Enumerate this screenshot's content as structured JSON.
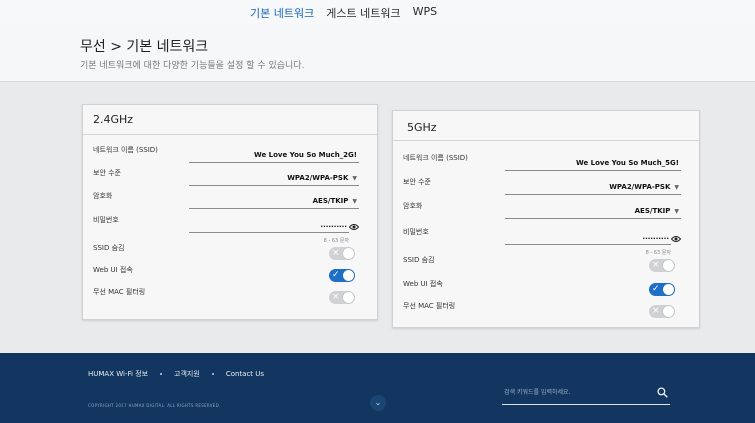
{
  "nav": {
    "tabs": [
      {
        "label": "기본 네트워크",
        "active": true
      },
      {
        "label": "게스트 네트워크",
        "active": false
      },
      {
        "label": "WPS",
        "active": false
      }
    ]
  },
  "header": {
    "title": "무선 > 기본 네트워크",
    "subtitle": "기본 네트워크에 대한 다양한 기능들을 설정 할 수 있습니다."
  },
  "panels": {
    "band24": {
      "title": "2.4GHz",
      "ssid_label": "네트워크 이름 (SSID)",
      "ssid_value": "We Love You So Much_2G!",
      "security_label": "보안 수준",
      "security_value": "WPA2/WPA-PSK",
      "encryption_label": "암호화",
      "encryption_value": "AES/TKIP",
      "password_label": "비밀번호",
      "password_value": "..........",
      "password_hint": "8 - 63 문자",
      "ssid_hide_label": "SSID 숨김",
      "ssid_hide_on": false,
      "webui_label": "Web UI 접속",
      "webui_on": true,
      "mac_label": "무선 MAC 필터링",
      "mac_on": false
    },
    "band5": {
      "title": "5GHz",
      "ssid_label": "네트워크 이름 (SSID)",
      "ssid_value": "We Love You So Much_5G!",
      "security_label": "보안 수준",
      "security_value": "WPA2/WPA-PSK",
      "encryption_label": "암호화",
      "encryption_value": "AES/TKIP",
      "password_label": "비밀번호",
      "password_value": "..........",
      "password_hint": "8 - 63 문자",
      "ssid_hide_label": "SSID 숨김",
      "ssid_hide_on": false,
      "webui_label": "Web UI 접속",
      "webui_on": true,
      "mac_label": "무선 MAC 필터링",
      "mac_on": false
    }
  },
  "footer": {
    "links": [
      "HUMAX Wi-Fi 정보",
      "고객지원",
      "Contact Us"
    ],
    "copyright": "COPYRIGHT 2017 HUMAX DIGITAL. ALL RIGHTS RESERVED.",
    "search_placeholder": "검색 키워드를 입력하세요."
  },
  "colors": {
    "brand": "#1565b8",
    "toggle_on": "#1f6fc8",
    "footer_bg": "#12365f"
  },
  "icons": [
    "eye-icon",
    "dropdown-caret-icon",
    "check-icon",
    "x-icon",
    "search-icon",
    "chevron-down-icon"
  ]
}
